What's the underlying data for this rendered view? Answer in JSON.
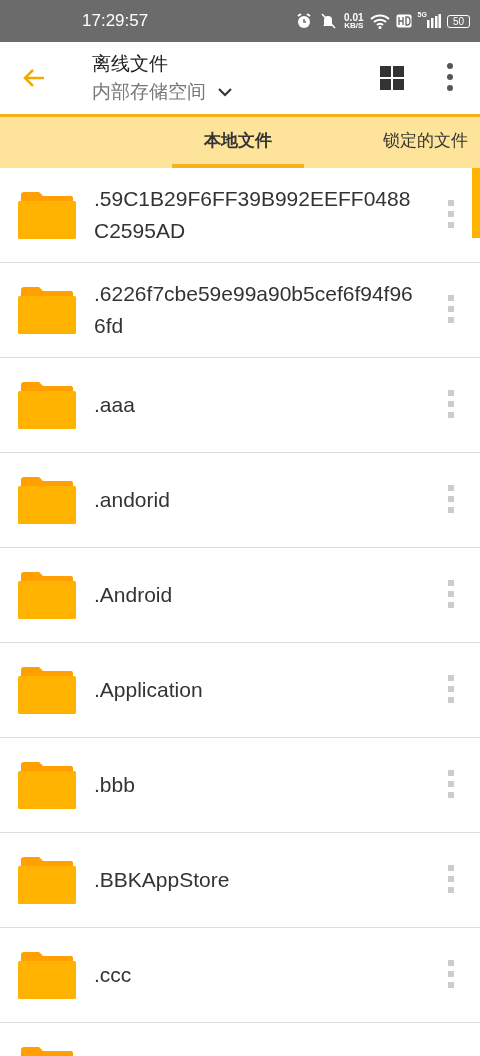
{
  "status_bar": {
    "time": "17:29:57",
    "net_speed": "0.01",
    "net_unit": "KB/S",
    "network": "5G",
    "battery": "50"
  },
  "app_bar": {
    "title": "离线文件",
    "subtitle": "内部存储空间"
  },
  "tabs": [
    {
      "label": "本地文件",
      "selected": true
    },
    {
      "label": "锁定的文件",
      "selected": false
    }
  ],
  "files": [
    {
      "name": ".59C1B29F6FF39B992EEFF0488C2595AD"
    },
    {
      "name": ".6226f7cbe59e99a90b5cef6f94f966fd"
    },
    {
      "name": ".aaa"
    },
    {
      "name": ".andorid"
    },
    {
      "name": ".Android"
    },
    {
      "name": ".Application"
    },
    {
      "name": ".bbb"
    },
    {
      "name": ".BBKAppStore"
    },
    {
      "name": ".ccc"
    }
  ]
}
